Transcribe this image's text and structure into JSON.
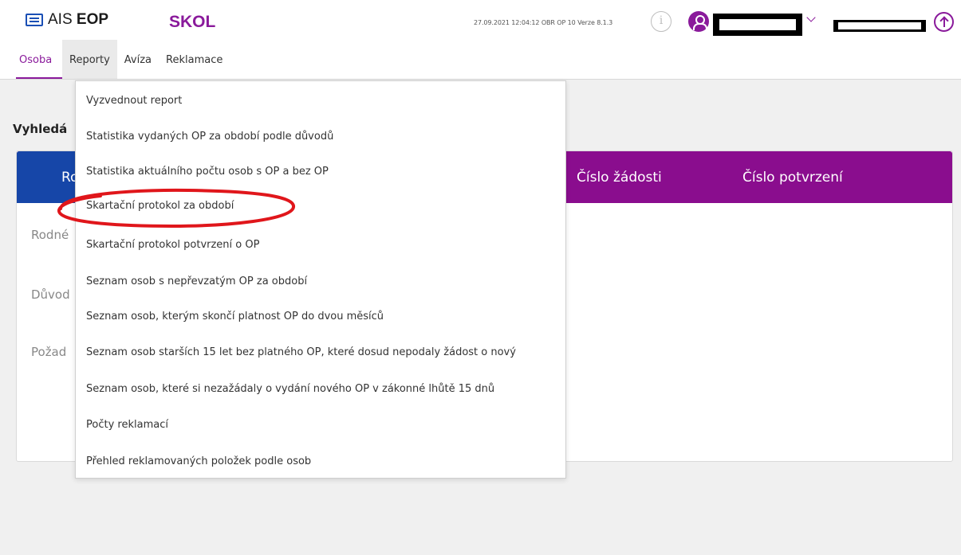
{
  "header": {
    "logo_prefix": "AIS",
    "logo_bold": "EOP",
    "app_name": "SKOL",
    "meta": "27.09.2021 12:04:12 OBR OP 10 Verze 8.1.3",
    "accent_color": "#8a1a9b",
    "icons": [
      "document-icon",
      "info-icon",
      "user-icon",
      "chevron-down-icon",
      "upload-icon"
    ]
  },
  "nav": {
    "items": [
      "Osoba",
      "Reporty",
      "Avíza",
      "Reklamace"
    ]
  },
  "page": {
    "heading_partial": "Vyhledá"
  },
  "panel": {
    "tab_partial": "Ro",
    "columns": [
      "Číslo žádosti",
      "Číslo potvrzení"
    ],
    "field_labels": [
      "Rodné",
      "Důvod",
      "Požad"
    ]
  },
  "dropdown": {
    "items": [
      "Vyzvednout report",
      "Statistika vydaných OP za období podle důvodů",
      "Statistika aktuálního počtu osob s OP a bez OP",
      "Skartační protokol za období",
      "Skartační protokol potvrzení o OP",
      "Seznam osob s nepřevzatým OP za období",
      "Seznam osob, kterým skončí platnost OP do dvou měsíců",
      "Seznam osob starších 15 let bez platného OP, které dosud nepodaly žádost o nový",
      "Seznam osob, které si nezažádaly o vydání nového OP v zákonné lhůtě 15 dnů",
      "Počty reklamací",
      "Přehled reklamovaných položek podle osob"
    ]
  }
}
